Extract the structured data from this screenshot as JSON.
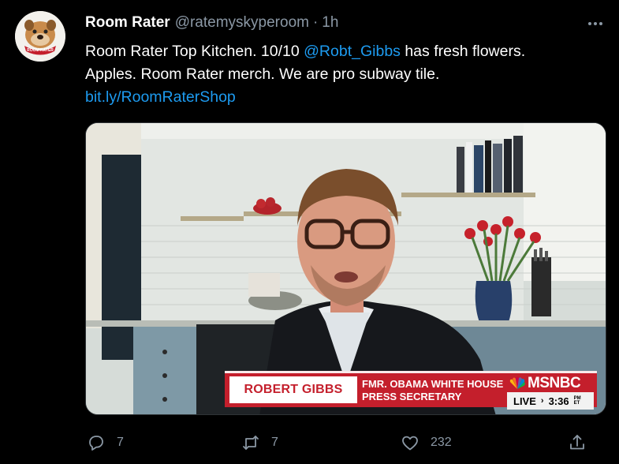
{
  "tweet": {
    "author_name": "Room Rater",
    "author_handle": "@ratemyskyperoom",
    "separator": "·",
    "time": "1h",
    "text_part1": "Room Rater Top Kitchen.  10/10 ",
    "mention": "@Robt_Gibbs",
    "text_part2": " has fresh flowers.",
    "text_line2": "Apples. Room Rater merch. We are pro subway tile.",
    "link": "bit.ly/RoomRaterShop"
  },
  "video": {
    "lower_third_name": "ROBERT GIBBS",
    "lower_third_title_line1": "FMR. OBAMA WHITE HOUSE",
    "lower_third_title_line2": "PRESS SECRETARY",
    "network": "MSNBC",
    "live_label": "LIVE",
    "live_time": "3:36",
    "live_tz": "PM ET"
  },
  "actions": {
    "reply_count": "7",
    "retweet_count": "7",
    "like_count": "232"
  },
  "colors": {
    "accent": "#1d9bf0",
    "muted": "#8b98a5",
    "background": "#000000",
    "msnbc_red": "#c41f2c"
  },
  "icons": {
    "reply": "reply-icon",
    "retweet": "retweet-icon",
    "like": "heart-icon",
    "share": "share-icon",
    "more": "more-icon"
  }
}
